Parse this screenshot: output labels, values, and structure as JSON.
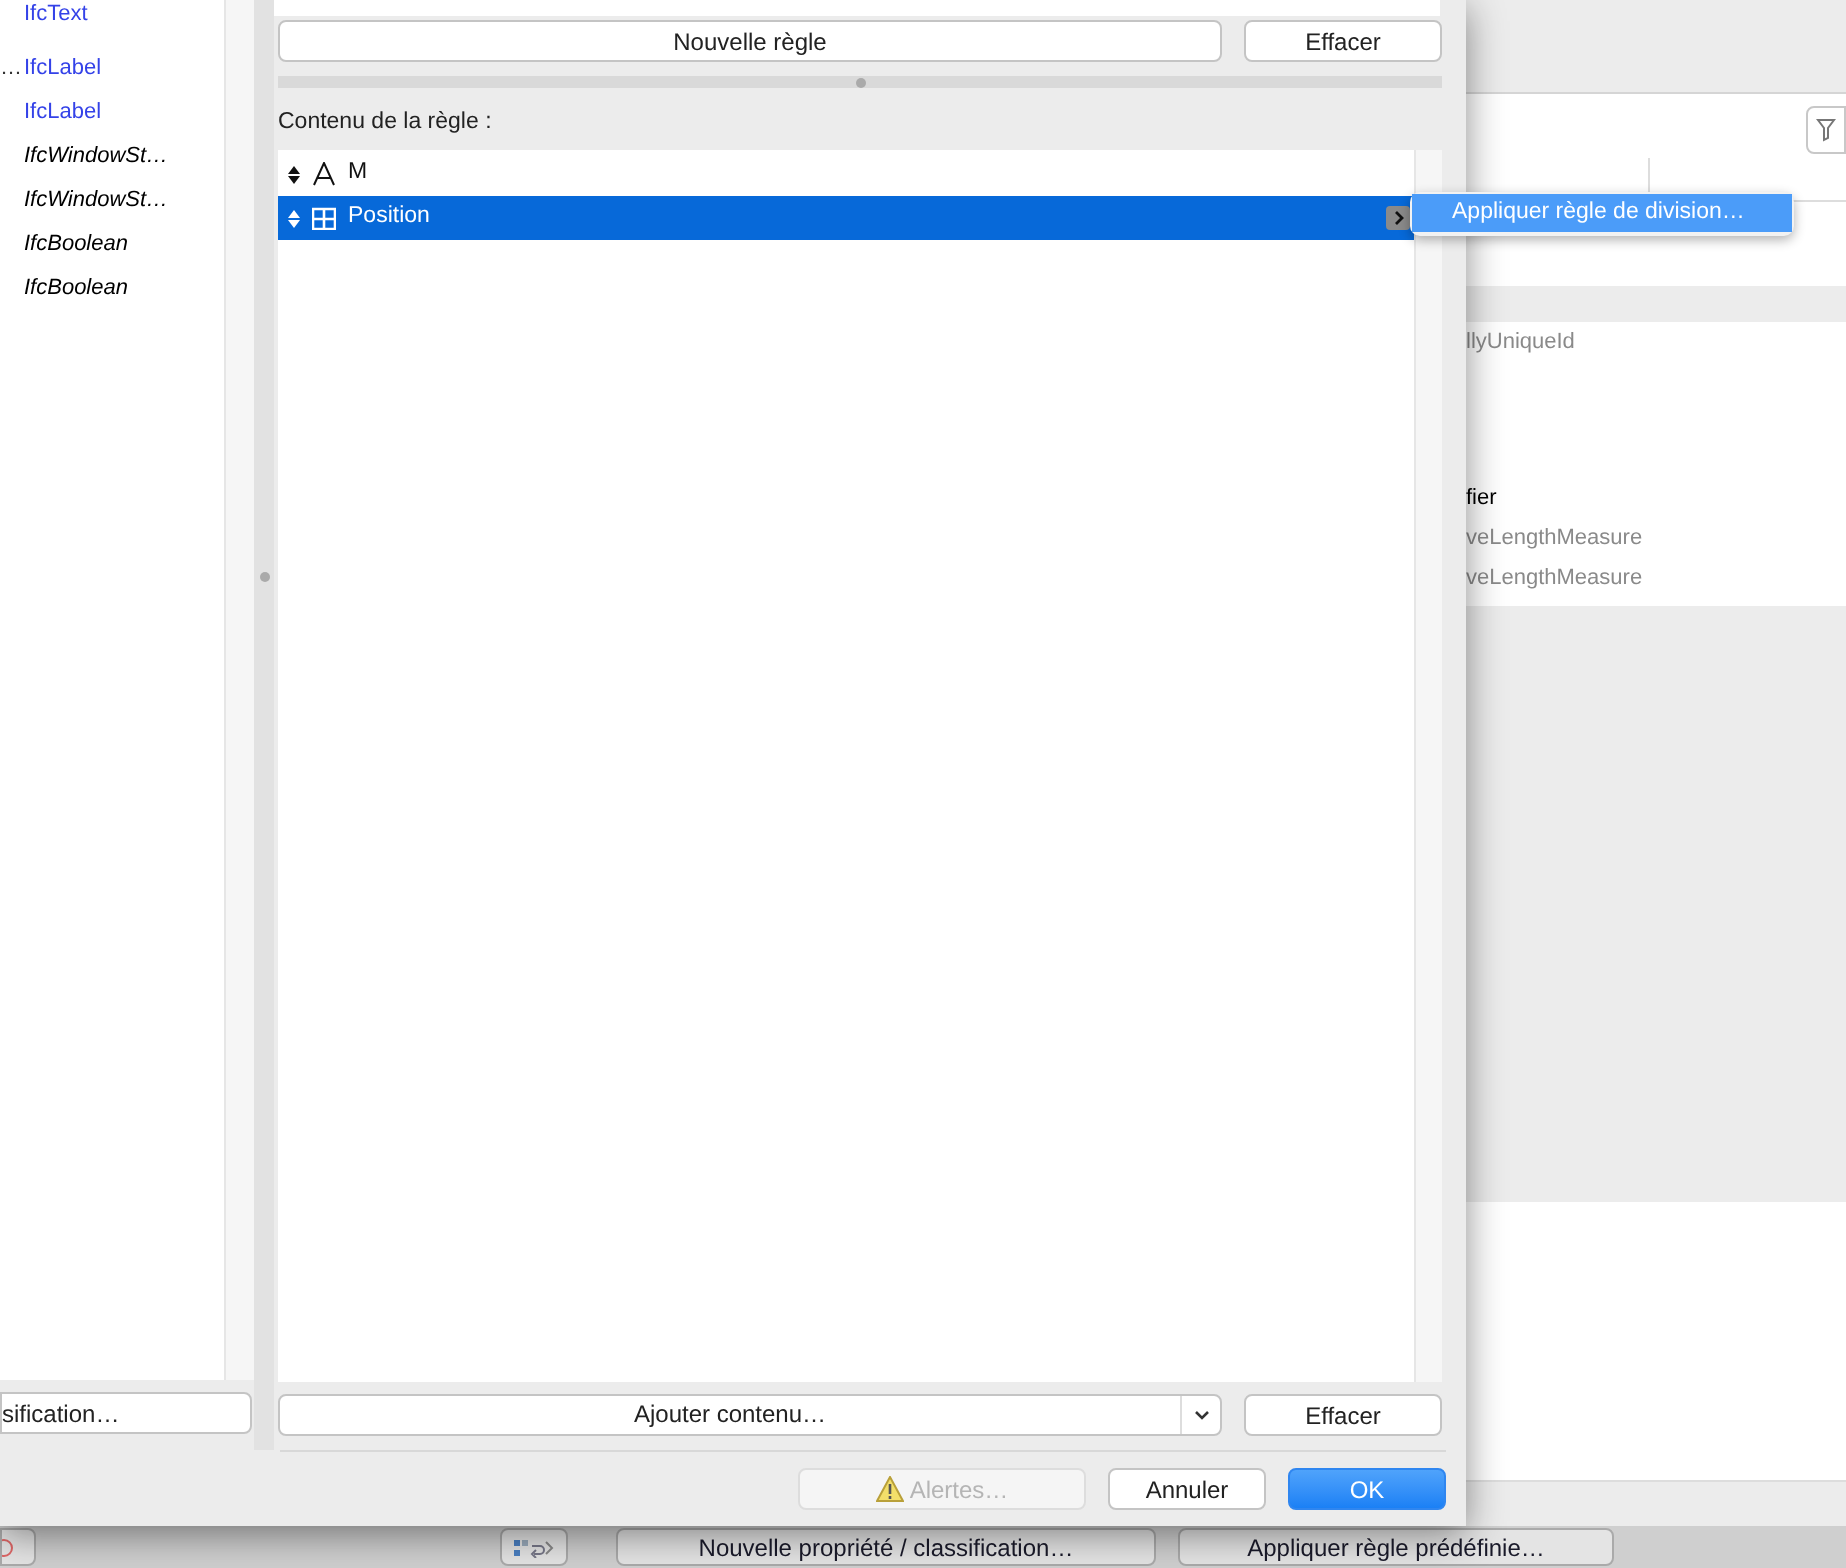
{
  "type_list": {
    "items": [
      {
        "text": "IfcText",
        "kind": "link"
      },
      {
        "prefix": "…",
        "text": "IfcLabel",
        "kind": "link"
      },
      {
        "text": "IfcLabel",
        "kind": "link"
      },
      {
        "text": "IfcWindowSt…",
        "kind": "type"
      },
      {
        "text": "IfcWindowSt…",
        "kind": "type"
      },
      {
        "text": "IfcBoolean",
        "kind": "type"
      },
      {
        "text": "IfcBoolean",
        "kind": "type"
      }
    ],
    "button": "sification…"
  },
  "rule_buttons": {
    "new_rule": "Nouvelle règle",
    "clear": "Effacer"
  },
  "content_label": "Contenu de la règle :",
  "content_rows": [
    {
      "label": "M",
      "kind": "text",
      "selected": false
    },
    {
      "label": "Position",
      "kind": "grid",
      "selected": true
    }
  ],
  "context_menu": {
    "items": [
      {
        "label": "Appliquer règle de division…",
        "selected": true
      }
    ]
  },
  "add_content": "Ajouter contenu…",
  "content_clear": "Effacer",
  "footer_buttons": [
    {
      "label": "Alertes…",
      "kind": "warning",
      "disabled": true
    },
    {
      "label": "Annuler",
      "kind": "normal",
      "disabled": false
    },
    {
      "label": "OK",
      "kind": "default",
      "disabled": false
    }
  ],
  "background": {
    "cells": [
      {
        "text": "llyUniqueId",
        "kind": "type"
      },
      {
        "text": "fier",
        "kind": "name"
      },
      {
        "text": "veLengthMeasure",
        "kind": "type"
      },
      {
        "text": "veLengthMeasure",
        "kind": "type"
      }
    ],
    "bottom_buttons": [
      "Nouvelle propriété / classification…",
      "Appliquer règle prédéfinie…"
    ]
  }
}
